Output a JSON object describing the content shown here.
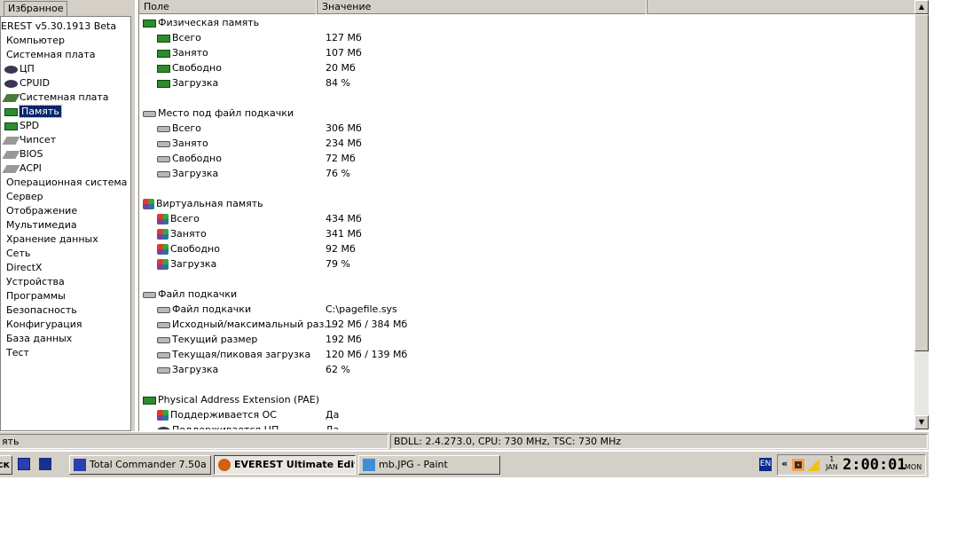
{
  "left": {
    "tab": "Избранное",
    "tree": [
      {
        "label": "EREST v5.30.1913 Beta",
        "icon": "",
        "x": 0
      },
      {
        "label": "Компьютер",
        "icon": "",
        "x": 6
      },
      {
        "label": "Системная плата",
        "icon": "",
        "x": 6
      },
      {
        "label": "ЦП",
        "icon": "cpu",
        "x": 6
      },
      {
        "label": "CPUID",
        "icon": "cpu",
        "x": 6
      },
      {
        "label": "Системная плата",
        "icon": "board",
        "x": 6
      },
      {
        "label": "Память",
        "icon": "mem",
        "x": 6,
        "selected": true
      },
      {
        "label": "SPD",
        "icon": "mem",
        "x": 6
      },
      {
        "label": "Чипсет",
        "icon": "chip",
        "x": 6
      },
      {
        "label": "BIOS",
        "icon": "chip",
        "x": 6
      },
      {
        "label": "ACPI",
        "icon": "chip",
        "x": 6
      },
      {
        "label": "Операционная система",
        "icon": "",
        "x": 6
      },
      {
        "label": "Сервер",
        "icon": "",
        "x": 6
      },
      {
        "label": "Отображение",
        "icon": "",
        "x": 6
      },
      {
        "label": "Мультимедиа",
        "icon": "",
        "x": 6
      },
      {
        "label": "Хранение данных",
        "icon": "",
        "x": 6
      },
      {
        "label": "Сеть",
        "icon": "",
        "x": 6
      },
      {
        "label": "DirectX",
        "icon": "",
        "x": 6
      },
      {
        "label": "Устройства",
        "icon": "",
        "x": 6
      },
      {
        "label": "Программы",
        "icon": "",
        "x": 6
      },
      {
        "label": "Безопасность",
        "icon": "",
        "x": 6
      },
      {
        "label": "Конфигурация",
        "icon": "",
        "x": 6
      },
      {
        "label": "База данных",
        "icon": "",
        "x": 6
      },
      {
        "label": "Тест",
        "icon": "",
        "x": 6
      }
    ]
  },
  "columns": {
    "field": "Поле",
    "value": "Значение"
  },
  "rows": [
    {
      "type": "group",
      "icon": "mem",
      "field": "Физическая память",
      "value": ""
    },
    {
      "icon": "mem",
      "field": "Всего",
      "value": "127 Мб"
    },
    {
      "icon": "mem",
      "field": "Занято",
      "value": "107 Мб"
    },
    {
      "icon": "mem",
      "field": "Свободно",
      "value": "20 Мб"
    },
    {
      "icon": "mem",
      "field": "Загрузка",
      "value": "84 %"
    },
    {
      "type": "blank"
    },
    {
      "type": "group",
      "icon": "hdd",
      "field": "Место под файл подкачки",
      "value": ""
    },
    {
      "icon": "hdd",
      "field": "Всего",
      "value": "306 Мб"
    },
    {
      "icon": "hdd",
      "field": "Занято",
      "value": "234 Мб"
    },
    {
      "icon": "hdd",
      "field": "Свободно",
      "value": "72 Мб"
    },
    {
      "icon": "hdd",
      "field": "Загрузка",
      "value": "76 %"
    },
    {
      "type": "blank"
    },
    {
      "type": "group",
      "icon": "win",
      "field": "Виртуальная память",
      "value": ""
    },
    {
      "icon": "win",
      "field": "Всего",
      "value": "434 Мб"
    },
    {
      "icon": "win",
      "field": "Занято",
      "value": "341 Мб"
    },
    {
      "icon": "win",
      "field": "Свободно",
      "value": "92 Мб"
    },
    {
      "icon": "win",
      "field": "Загрузка",
      "value": "79 %"
    },
    {
      "type": "blank"
    },
    {
      "type": "group",
      "icon": "hdd",
      "field": "Файл подкачки",
      "value": ""
    },
    {
      "icon": "hdd",
      "field": "Файл подкачки",
      "value": "C:\\pagefile.sys"
    },
    {
      "icon": "hdd",
      "field": "Исходный/максимальный раз...",
      "value": "192 Мб / 384 Мб"
    },
    {
      "icon": "hdd",
      "field": "Текущий размер",
      "value": "192 Мб"
    },
    {
      "icon": "hdd",
      "field": "Текущая/пиковая загрузка",
      "value": "120 Мб / 139 Мб"
    },
    {
      "icon": "hdd",
      "field": "Загрузка",
      "value": "62 %"
    },
    {
      "type": "blank"
    },
    {
      "type": "group",
      "icon": "mem",
      "field": "Physical Address Extension (PAE)",
      "value": ""
    },
    {
      "icon": "win",
      "field": "Поддерживается ОС",
      "value": "Да"
    },
    {
      "icon": "cpu",
      "field": "Поддерживается ЦП",
      "value": "Да"
    }
  ],
  "status": {
    "left": "ять",
    "right": "BDLL: 2.4.273.0, CPU: 730 MHz, TSC: 730 MHz"
  },
  "taskbar": {
    "start": "ск",
    "buttons": [
      {
        "label": "Total Commander 7.50a ...",
        "active": false
      },
      {
        "label": "EVEREST Ultimate Edit...",
        "active": true
      },
      {
        "label": "mb.JPG - Paint",
        "active": false
      }
    ],
    "lang": "EN",
    "chevron": "«",
    "clock": {
      "day": "1",
      "month": "JAN",
      "time": "2:00:01",
      "weekday": "MON"
    }
  }
}
